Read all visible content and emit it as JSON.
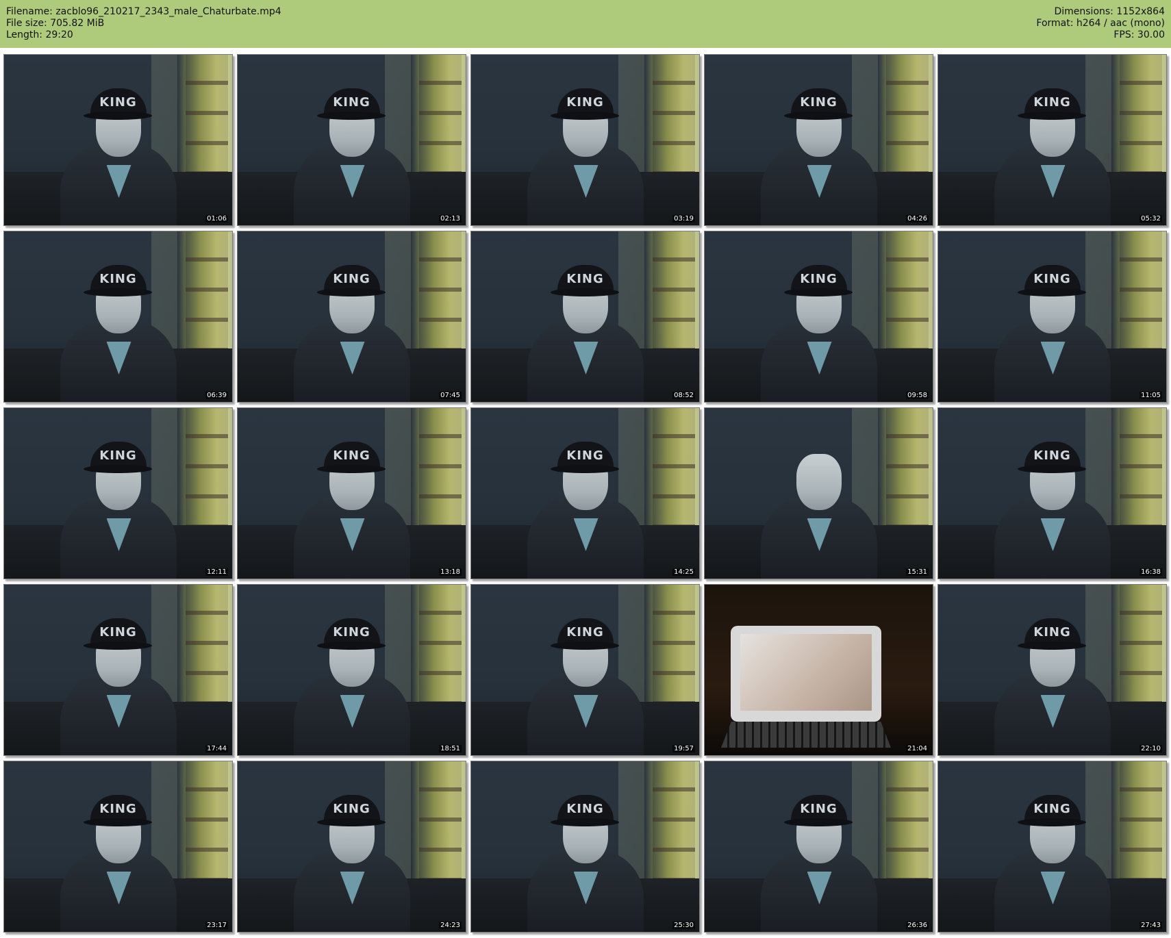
{
  "header": {
    "filename_label": "Filename:",
    "filename": "zacblo96_210217_2343_male_Chaturbate.mp4",
    "filesize_label": "File size:",
    "filesize": "705.82 MiB",
    "length_label": "Length:",
    "length": "29:20",
    "dimensions_label": "Dimensions:",
    "dimensions": "1152x864",
    "format_label": "Format:",
    "format": "h264 / aac (mono)",
    "fps_label": "FPS:",
    "fps": "30.00"
  },
  "colors": {
    "header_bg": "#aecb7c"
  },
  "cap_text": "KING",
  "thumbnails": [
    {
      "time": "01:06"
    },
    {
      "time": "02:13"
    },
    {
      "time": "03:19"
    },
    {
      "time": "04:26"
    },
    {
      "time": "05:32"
    },
    {
      "time": "06:39"
    },
    {
      "time": "07:45"
    },
    {
      "time": "08:52"
    },
    {
      "time": "09:58"
    },
    {
      "time": "11:05"
    },
    {
      "time": "12:11"
    },
    {
      "time": "13:18"
    },
    {
      "time": "14:25"
    },
    {
      "time": "15:31"
    },
    {
      "time": "16:38"
    },
    {
      "time": "17:44"
    },
    {
      "time": "18:51"
    },
    {
      "time": "19:57"
    },
    {
      "time": "21:04"
    },
    {
      "time": "22:10"
    },
    {
      "time": "23:17"
    },
    {
      "time": "24:23"
    },
    {
      "time": "25:30"
    },
    {
      "time": "26:36"
    },
    {
      "time": "27:43"
    }
  ]
}
